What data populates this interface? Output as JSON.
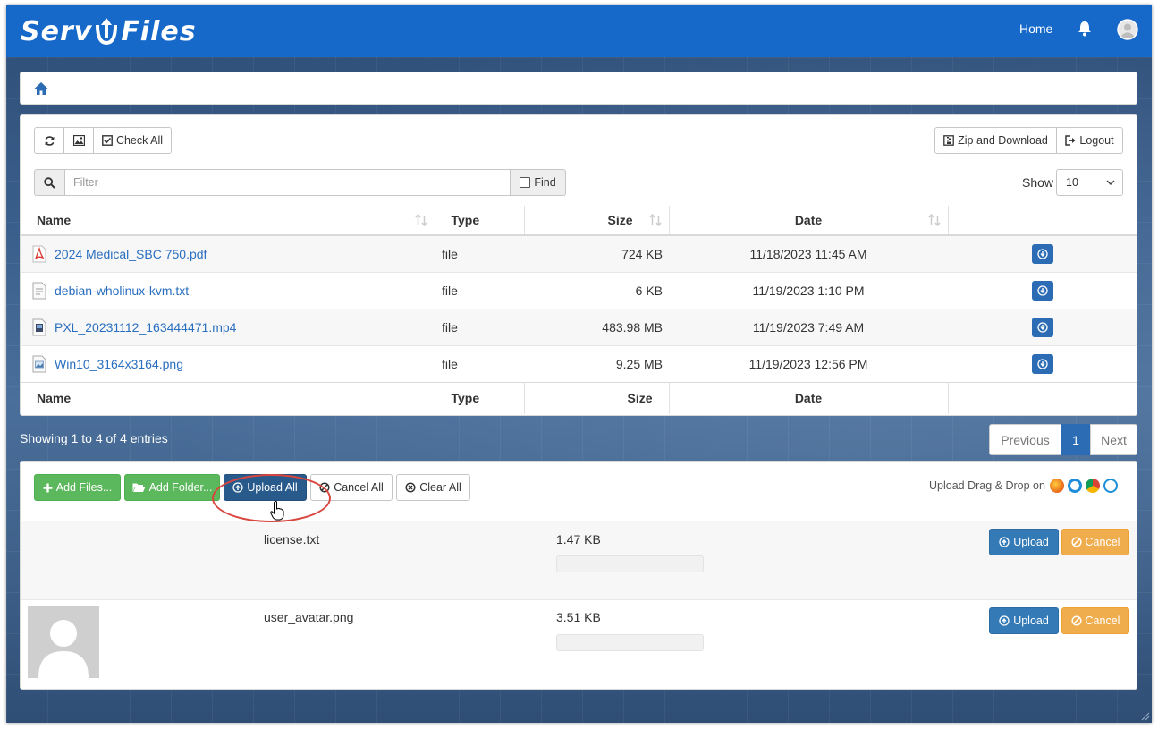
{
  "app": {
    "logo_left": "Serv",
    "logo_right": "Files",
    "nav_home": "Home",
    "brand_color": "#1669c9"
  },
  "toolbar": {
    "check_all": "Check All",
    "zip_download": "Zip and Download",
    "logout": "Logout"
  },
  "filter": {
    "placeholder": "Filter",
    "find": "Find",
    "show_label": "Show",
    "show_value": "10"
  },
  "table": {
    "headers": {
      "name": "Name",
      "type": "Type",
      "size": "Size",
      "date": "Date"
    },
    "rows": [
      {
        "name": "2024 Medical_SBC 750.pdf",
        "type": "file",
        "size": "724 KB",
        "date": "11/18/2023 11:45 AM",
        "icon": "pdf-file-icon"
      },
      {
        "name": "debian-wholinux-kvm.txt",
        "type": "file",
        "size": "6 KB",
        "date": "11/19/2023 1:10 PM",
        "icon": "text-file-icon"
      },
      {
        "name": "PXL_20231112_163444471.mp4",
        "type": "file",
        "size": "483.98 MB",
        "date": "11/19/2023 7:49 AM",
        "icon": "video-file-icon"
      },
      {
        "name": "Win10_3164x3164.png",
        "type": "file",
        "size": "9.25 MB",
        "date": "11/19/2023 12:56 PM",
        "icon": "image-file-icon"
      }
    ]
  },
  "pagination": {
    "showing": "Showing 1 to 4 of 4 entries",
    "previous": "Previous",
    "current": "1",
    "next": "Next"
  },
  "upload": {
    "add_files": "Add Files...",
    "add_folder": "Add Folder...",
    "upload_all": "Upload All",
    "cancel_all": "Cancel All",
    "clear_all": "Clear All",
    "drag_drop": "Upload Drag & Drop on",
    "items": [
      {
        "name": "license.txt",
        "size": "1.47 KB",
        "upload": "Upload",
        "cancel": "Cancel",
        "progress": 0
      },
      {
        "name": "user_avatar.png",
        "size": "3.51 KB",
        "upload": "Upload",
        "cancel": "Cancel",
        "progress": 0
      }
    ]
  }
}
